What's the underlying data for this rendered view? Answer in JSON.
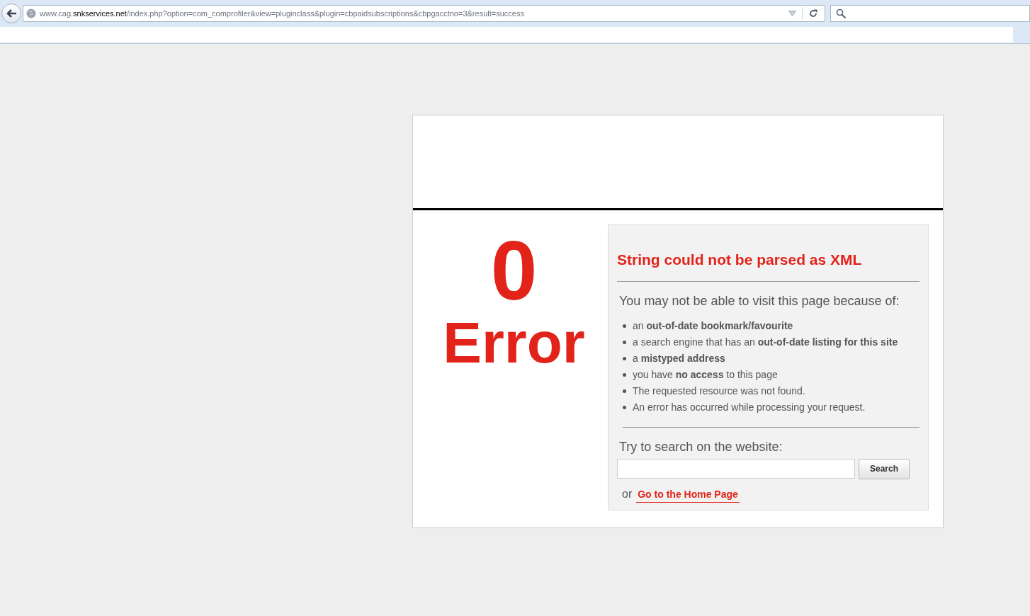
{
  "browser": {
    "url": [
      {
        "text": "www.cag.",
        "emphasis": false
      },
      {
        "text": "snkservices.net",
        "emphasis": true
      },
      {
        "text": "/index.php?option=com_comprofiler&view=pluginclass&plugin=cbpaidsubscriptions&cbpgacctno=3&result=success",
        "emphasis": false
      }
    ]
  },
  "error": {
    "code": "0",
    "label": "Error"
  },
  "panel": {
    "title": "String could not be parsed as XML",
    "intro": "You may not be able to visit this page because of:",
    "reasons": [
      "an **out-of-date bookmark/favourite**",
      "a search engine that has an **out-of-date listing for this site**",
      "a **mistyped address**",
      "you have **no access** to this page",
      "The requested resource was not found.",
      "An error has occurred while processing your request."
    ],
    "search_prompt": "Try to search on the website:",
    "search_button": "Search",
    "or": "or",
    "home_link": "Go to the Home Page"
  }
}
